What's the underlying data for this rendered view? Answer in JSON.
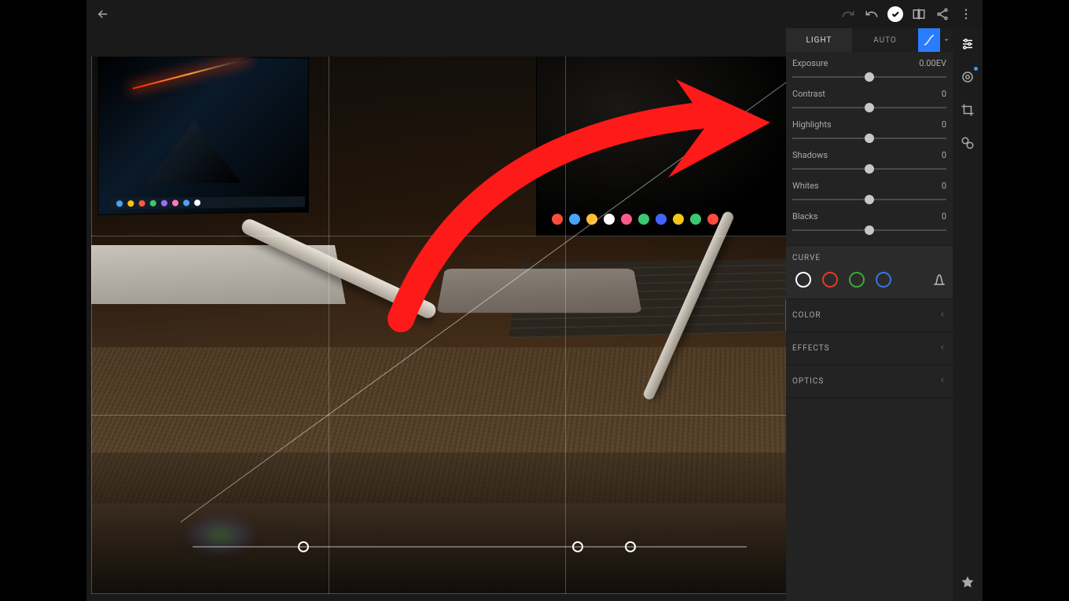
{
  "topbar": {
    "back": "back",
    "redo": "redo",
    "undo": "undo",
    "confirm": "confirm",
    "compare": "compare",
    "share": "share",
    "more": "more"
  },
  "tabs": {
    "light": "LIGHT",
    "auto": "AUTO"
  },
  "sliders": {
    "exposure": {
      "label": "Exposure",
      "value": "0.00EV"
    },
    "contrast": {
      "label": "Contrast",
      "value": "0"
    },
    "highlights": {
      "label": "Highlights",
      "value": "0"
    },
    "shadows": {
      "label": "Shadows",
      "value": "0"
    },
    "whites": {
      "label": "Whites",
      "value": "0"
    },
    "blacks": {
      "label": "Blacks",
      "value": "0"
    }
  },
  "curve": {
    "title": "CURVE",
    "channels": [
      "white",
      "red",
      "green",
      "blue"
    ]
  },
  "sections": {
    "color": "COLOR",
    "effects": "EFFECTS",
    "optics": "OPTICS"
  },
  "rail": {
    "adjust": "adjust",
    "target": "target-adjust",
    "crop": "crop",
    "presets": "presets",
    "star": "star"
  }
}
